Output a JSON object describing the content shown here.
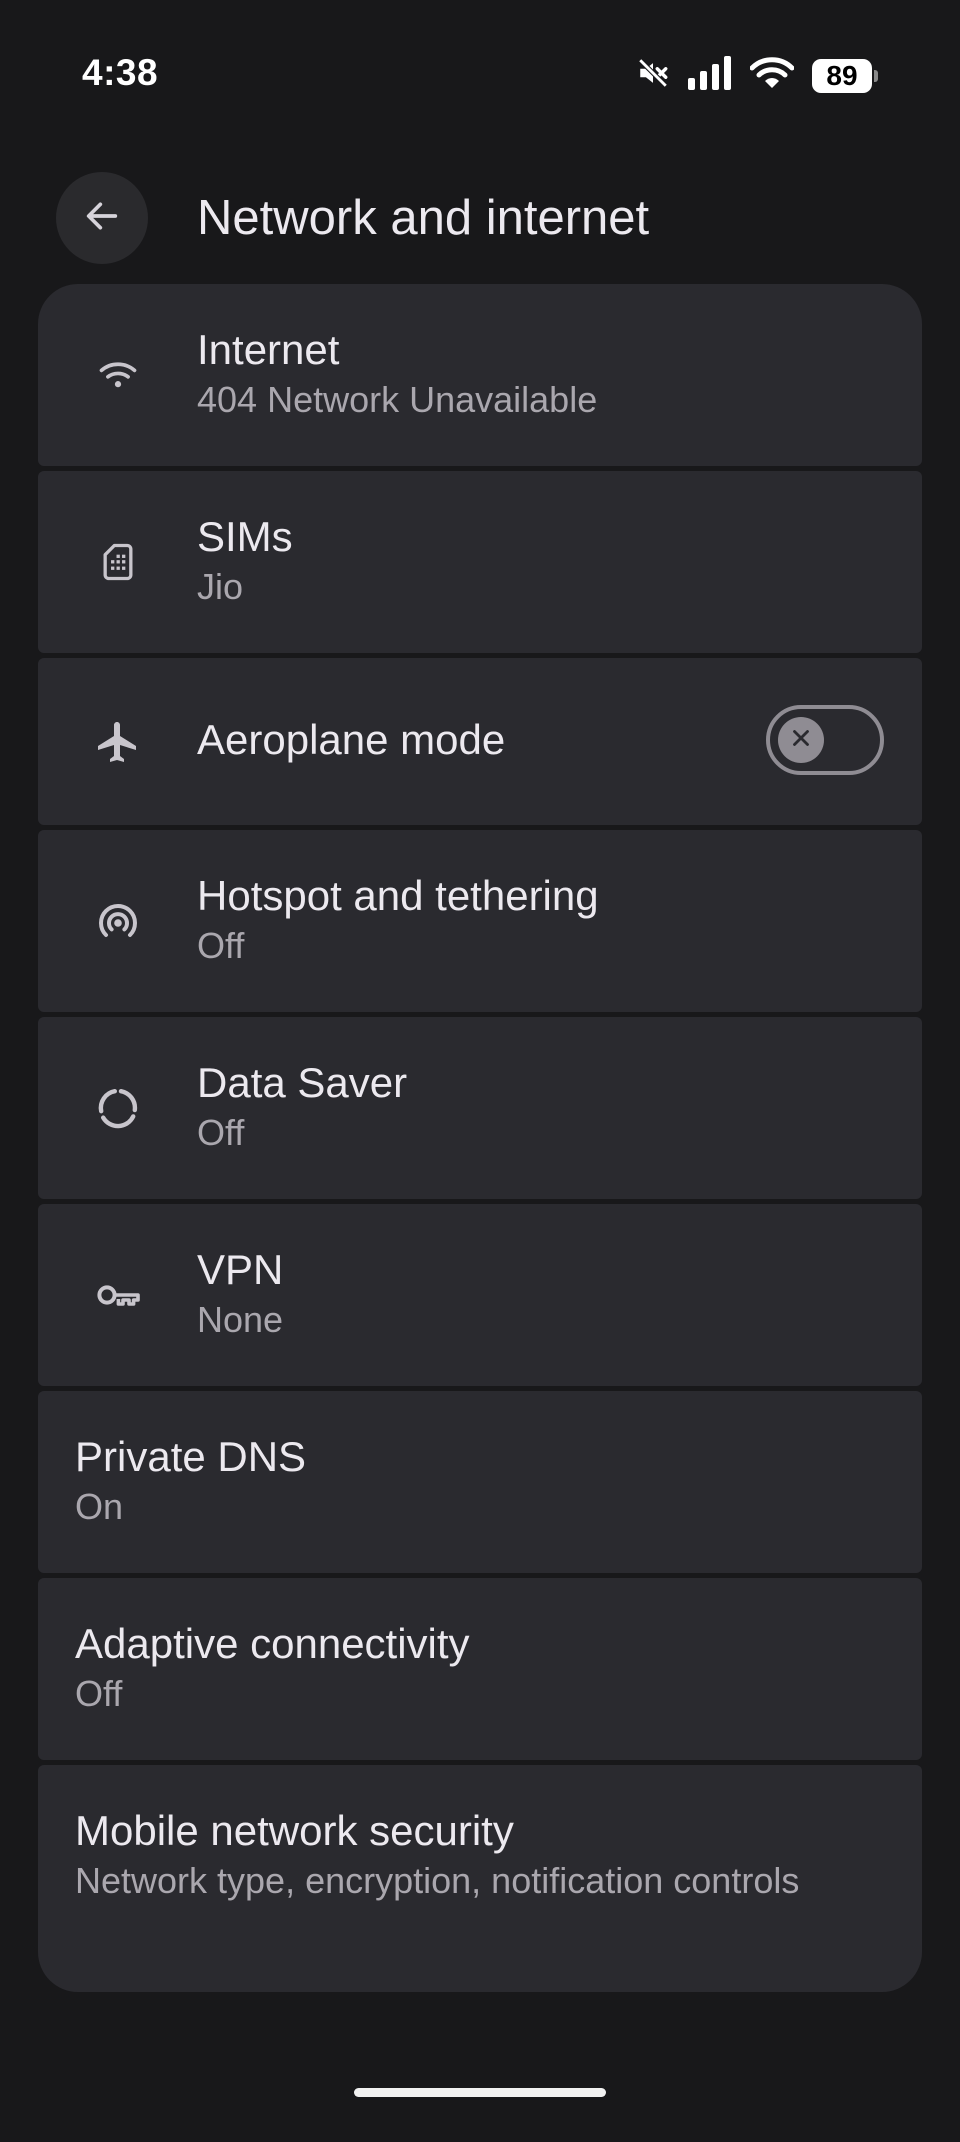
{
  "status_bar": {
    "time": "4:38",
    "battery_level": "89",
    "icons": [
      "mute-icon",
      "signal-icon",
      "wifi-icon",
      "battery-icon"
    ]
  },
  "header": {
    "title": "Network and internet",
    "back_icon": "arrow-back-icon"
  },
  "items": [
    {
      "id": "internet",
      "title": "Internet",
      "summary": "404 Network Unavailable",
      "icon": "wifi-icon"
    },
    {
      "id": "sims",
      "title": "SIMs",
      "summary": "Jio",
      "icon": "sim-card-icon"
    },
    {
      "id": "aeroplane",
      "title": "Aeroplane mode",
      "icon": "airplane-icon",
      "toggle": false
    },
    {
      "id": "hotspot",
      "title": "Hotspot and tethering",
      "summary": "Off",
      "icon": "hotspot-icon"
    },
    {
      "id": "datasaver",
      "title": "Data Saver",
      "summary": "Off",
      "icon": "data-saver-icon"
    },
    {
      "id": "vpn",
      "title": "VPN",
      "summary": "None",
      "icon": "key-icon"
    },
    {
      "id": "privatedns",
      "title": "Private DNS",
      "summary": "On"
    },
    {
      "id": "adaptive",
      "title": "Adaptive connectivity",
      "summary": "Off"
    },
    {
      "id": "security",
      "title": "Mobile network security",
      "summary": "Network type, encryption, notification controls"
    }
  ],
  "colors": {
    "background": "#18181a",
    "card": "#2a2a2f",
    "text_primary": "#ece9ef",
    "text_secondary": "#aaa7ae",
    "toggle_outline": "#8f8c93"
  }
}
